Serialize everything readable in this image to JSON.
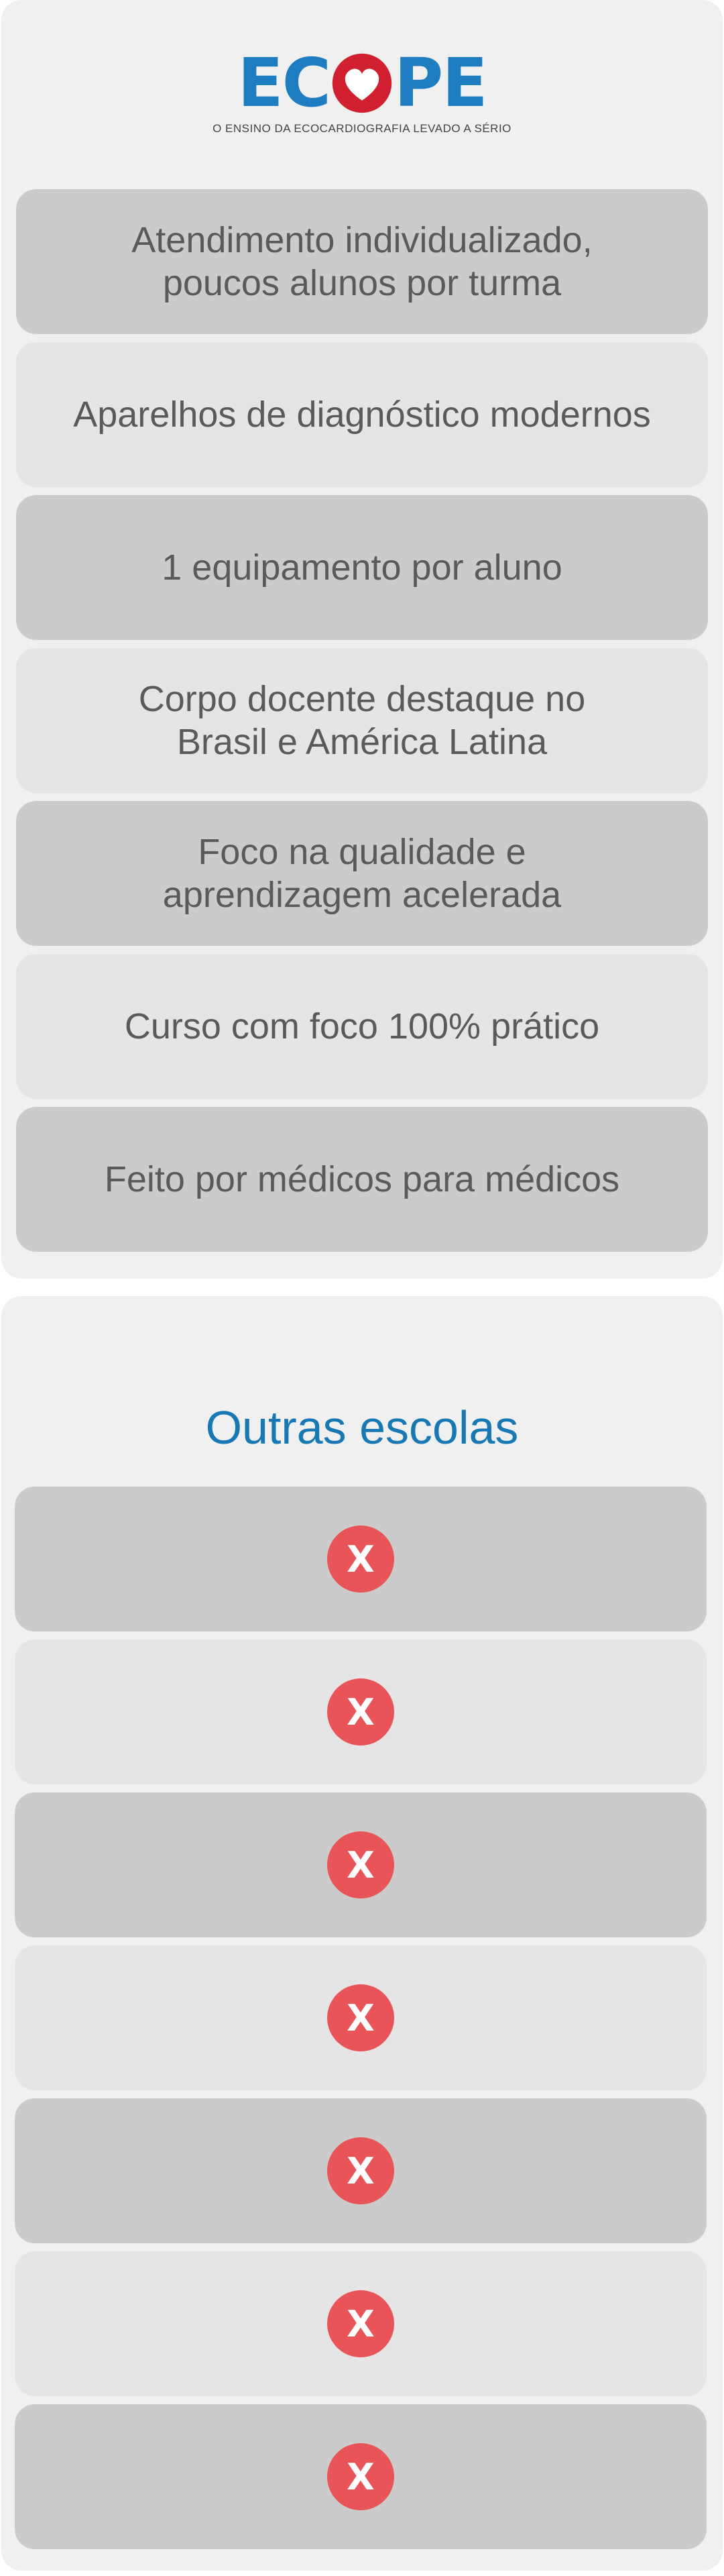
{
  "brand": {
    "logo_text_left": "EC",
    "logo_text_right": "PE",
    "logo_heart_icon": "heart-icon",
    "tagline": "O ENSINO DA ECOCARDIOGRAFIA LEVADO A SÉRIO",
    "color": "#1e7cc0",
    "heart_color": "#d01f2f"
  },
  "features": [
    {
      "label": "Atendimento individualizado,\npoucos alunos por turma"
    },
    {
      "label": "Aparelhos de diagnóstico modernos"
    },
    {
      "label": "1 equipamento  por aluno"
    },
    {
      "label": "Corpo docente destaque no\nBrasil e América Latina"
    },
    {
      "label": "Foco na qualidade e\naprendizagem acelerada"
    },
    {
      "label": "Curso com foco 100% prático"
    },
    {
      "label": "Feito por médicos para médicos"
    }
  ],
  "other_schools": {
    "title": "Outras escolas",
    "title_color": "#1878b4",
    "marks": [
      {
        "symbol": "X"
      },
      {
        "symbol": "X"
      },
      {
        "symbol": "X"
      },
      {
        "symbol": "X"
      },
      {
        "symbol": "X"
      },
      {
        "symbol": "X"
      },
      {
        "symbol": "X"
      }
    ],
    "mark_color": "#e95458"
  }
}
